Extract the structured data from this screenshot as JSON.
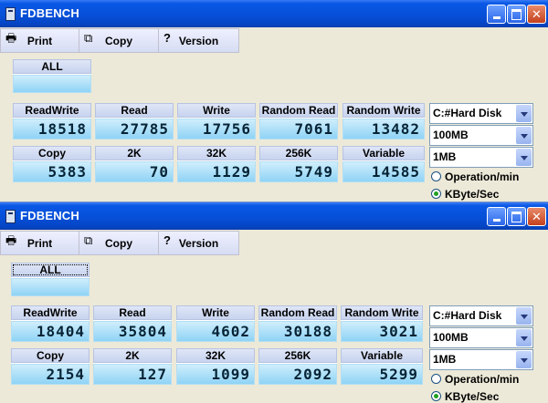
{
  "windows": [
    {
      "title": "FDBENCH",
      "toolbar": {
        "print": {
          "label": "Print",
          "icon": "printer-icon"
        },
        "copy": {
          "label": "Copy",
          "icon": "copy-icon"
        },
        "version": {
          "label": "Version",
          "icon": "question-icon"
        }
      },
      "all_label": "ALL",
      "metrics_row1": [
        {
          "label": "ReadWrite",
          "value": "18518"
        },
        {
          "label": "Read",
          "value": "27785"
        },
        {
          "label": "Write",
          "value": "17756"
        },
        {
          "label": "Random Read",
          "value": "7061"
        },
        {
          "label": "Random Write",
          "value": "13482"
        }
      ],
      "metrics_row2": [
        {
          "label": "Copy",
          "value": "5383"
        },
        {
          "label": "2K",
          "value": "70"
        },
        {
          "label": "32K",
          "value": "1129"
        },
        {
          "label": "256K",
          "value": "5749"
        },
        {
          "label": "Variable",
          "value": "14585"
        }
      ],
      "drive": "C:#Hard Disk",
      "size": "100MB",
      "block": "1MB",
      "radio_ops": "Operation/min",
      "radio_kb": "KByte/Sec"
    },
    {
      "title": "FDBENCH",
      "toolbar": {
        "print": {
          "label": "Print",
          "icon": "printer-icon"
        },
        "copy": {
          "label": "Copy",
          "icon": "copy-icon"
        },
        "version": {
          "label": "Version",
          "icon": "question-icon"
        }
      },
      "all_label": "ALL",
      "metrics_row1": [
        {
          "label": "ReadWrite",
          "value": "18404"
        },
        {
          "label": "Read",
          "value": "35804"
        },
        {
          "label": "Write",
          "value": "4602"
        },
        {
          "label": "Random Read",
          "value": "30188"
        },
        {
          "label": "Random Write",
          "value": "3021"
        }
      ],
      "metrics_row2": [
        {
          "label": "Copy",
          "value": "2154"
        },
        {
          "label": "2K",
          "value": "127"
        },
        {
          "label": "32K",
          "value": "1099"
        },
        {
          "label": "256K",
          "value": "2092"
        },
        {
          "label": "Variable",
          "value": "5299"
        }
      ],
      "drive": "C:#Hard Disk",
      "size": "100MB",
      "block": "1MB",
      "radio_ops": "Operation/min",
      "radio_kb": "KByte/Sec"
    }
  ],
  "colors": {
    "titlebar": "#0650d8",
    "panel_value_bg": "#a8dcf6",
    "panel_header_bg": "#d3dcf2",
    "radio_selected": "#21a121"
  }
}
